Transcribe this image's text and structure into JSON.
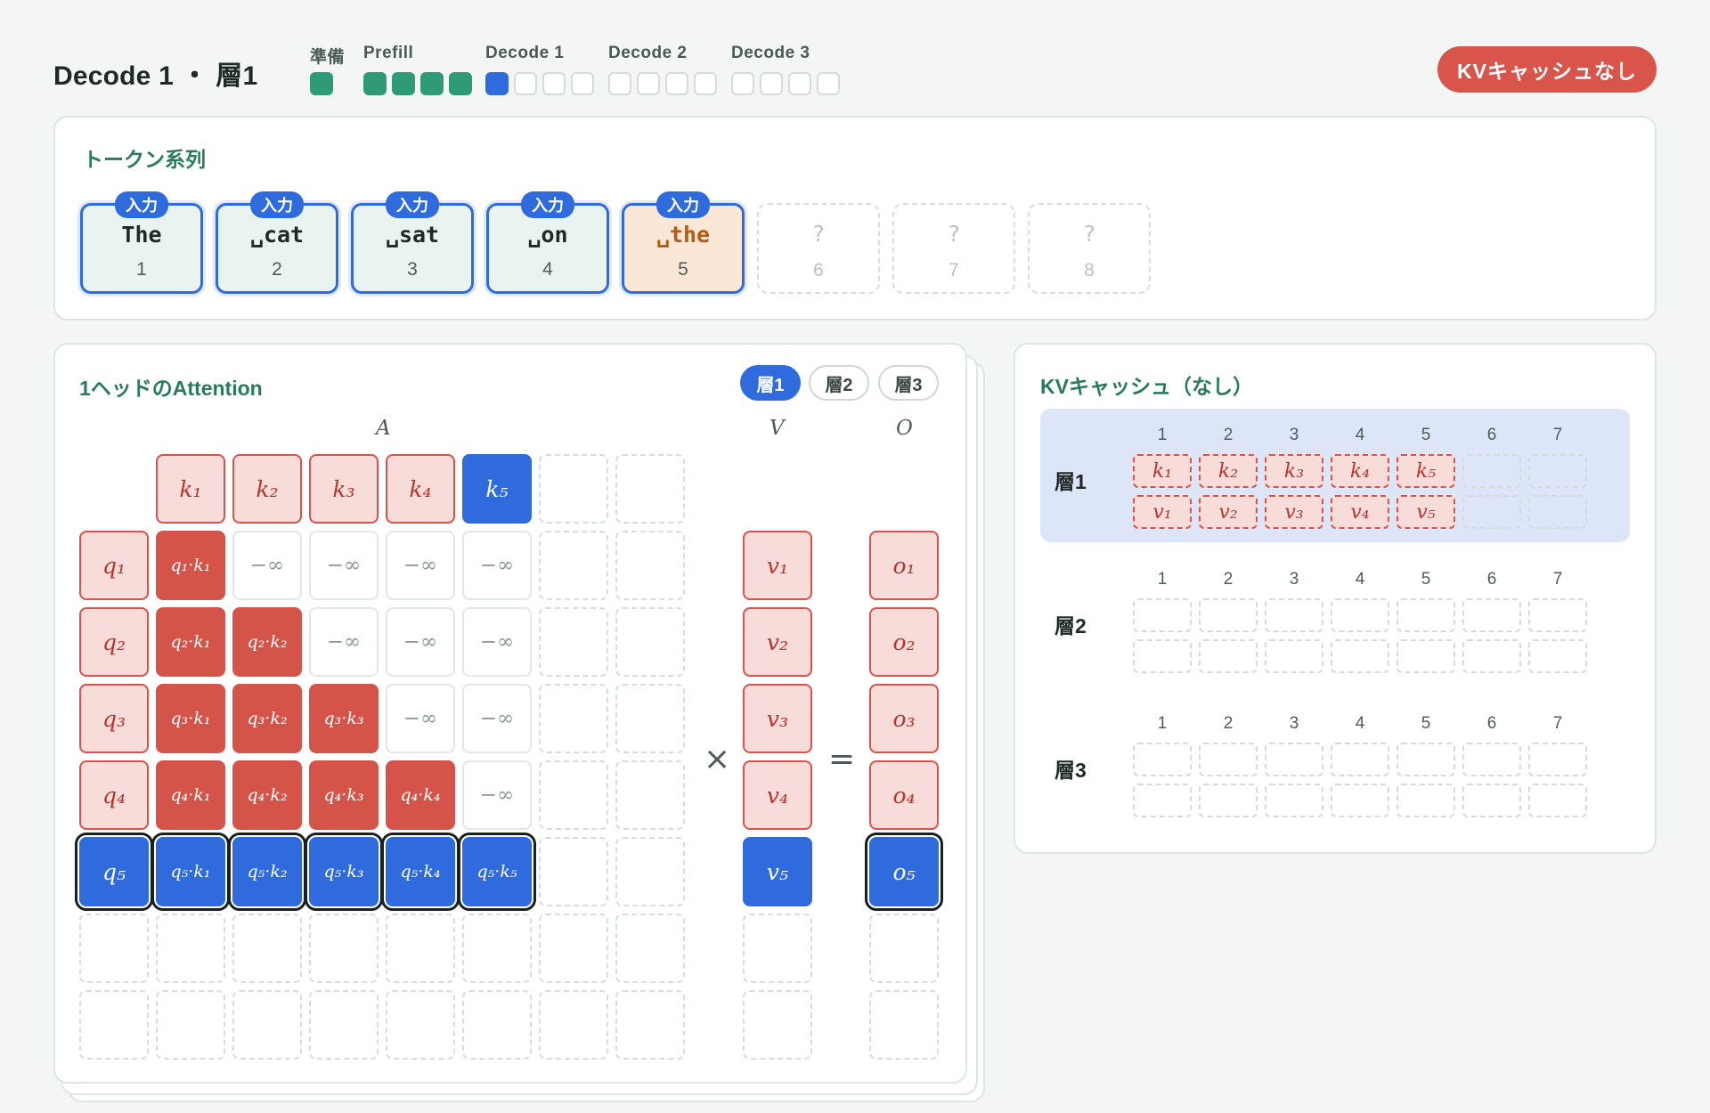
{
  "header": {
    "title": "Decode 1 ・ 層1",
    "kv_button": "KVキャッシュなし",
    "phases": [
      {
        "label": "準備",
        "boxes": [
          "done"
        ]
      },
      {
        "label": "Prefill",
        "boxes": [
          "done",
          "done",
          "done",
          "done"
        ]
      },
      {
        "label": "Decode 1",
        "boxes": [
          "cur",
          "empty",
          "empty",
          "empty"
        ]
      },
      {
        "label": "Decode 2",
        "boxes": [
          "empty",
          "empty",
          "empty",
          "empty"
        ]
      },
      {
        "label": "Decode 3",
        "boxes": [
          "empty",
          "empty",
          "empty",
          "empty"
        ]
      }
    ]
  },
  "tokens": {
    "title": "トークン系列",
    "badge": "入力",
    "items": [
      {
        "text": "␣The",
        "display": "The",
        "index": "1",
        "state": "input"
      },
      {
        "text": "␣cat",
        "display": "␣cat",
        "index": "2",
        "state": "input"
      },
      {
        "text": "␣sat",
        "display": "␣sat",
        "index": "3",
        "state": "input"
      },
      {
        "text": "␣on",
        "display": "␣on",
        "index": "4",
        "state": "input"
      },
      {
        "text": "␣the",
        "display": "␣the",
        "index": "5",
        "state": "current"
      },
      {
        "text": "?",
        "display": "?",
        "index": "6",
        "state": "ghost"
      },
      {
        "text": "?",
        "display": "?",
        "index": "7",
        "state": "ghost"
      },
      {
        "text": "?",
        "display": "?",
        "index": "8",
        "state": "ghost"
      }
    ]
  },
  "attention": {
    "title": "1ヘッドのAttention",
    "layers": [
      "層1",
      "層2",
      "層3"
    ],
    "active_layer": "層1",
    "labels": {
      "A": "A",
      "V": "V",
      "O": "O"
    },
    "times": "×",
    "equals": "=",
    "neg_inf": "−∞"
  },
  "kv_cache": {
    "title": "KVキャッシュ（なし）",
    "columns": [
      "1",
      "2",
      "3",
      "4",
      "5",
      "6",
      "7"
    ],
    "layers": [
      {
        "name": "層1",
        "k": [
          "k₁",
          "k₂",
          "k₃",
          "k₄",
          "k₅"
        ],
        "v": [
          "v₁",
          "v₂",
          "v₃",
          "v₄",
          "v₅"
        ],
        "highlight": true
      },
      {
        "name": "層2",
        "k": [],
        "v": [],
        "highlight": false
      },
      {
        "name": "層3",
        "k": [],
        "v": [],
        "highlight": false
      }
    ]
  },
  "colors": {
    "accent_blue": "#2f6bdc",
    "attention_red": "#d5544a",
    "done_green": "#2e9a77",
    "title_green": "#2a7a5c"
  }
}
